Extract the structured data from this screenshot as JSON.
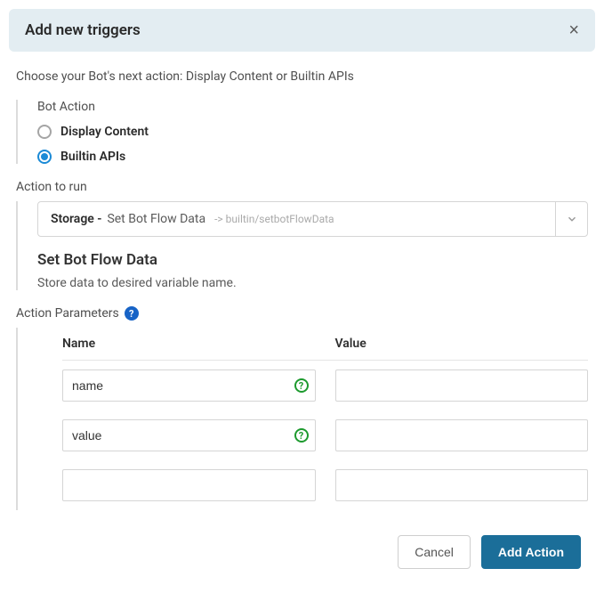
{
  "header": {
    "title": "Add new triggers"
  },
  "intro": "Choose your Bot's next action: Display Content or Builtin APIs",
  "botAction": {
    "label": "Bot Action",
    "options": [
      {
        "label": "Display Content",
        "selected": false
      },
      {
        "label": "Builtin APIs",
        "selected": true
      }
    ]
  },
  "actionToRun": {
    "label": "Action to run",
    "prefix": "Storage -",
    "title": "Set Bot Flow Data",
    "path": "-> builtin/setbotFlowData",
    "displayName": "Set Bot Flow Data",
    "description": "Store data to desired variable name."
  },
  "actionParameters": {
    "label": "Action Parameters",
    "columns": {
      "name": "Name",
      "value": "Value"
    },
    "rows": [
      {
        "name": "name",
        "value": "",
        "hasHelp": true
      },
      {
        "name": "value",
        "value": "",
        "hasHelp": true
      },
      {
        "name": "",
        "value": "",
        "hasHelp": false
      }
    ]
  },
  "footer": {
    "cancel": "Cancel",
    "submit": "Add Action"
  }
}
